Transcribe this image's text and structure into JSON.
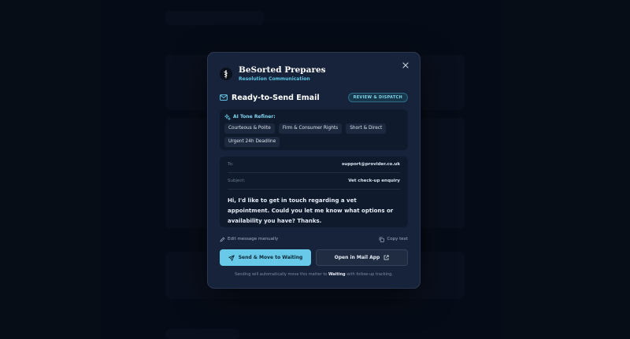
{
  "brand": {
    "title": "BeSorted Prepares",
    "subtitle": "Resolution Communication"
  },
  "email": {
    "title": "Ready-to-Send Email",
    "badge": "REVIEW & DISPATCH",
    "to_label": "To:",
    "to_value": "support@provider.co.uk",
    "subject_label": "Subject:",
    "subject_value": "Vet check-up enquiry",
    "body": "Hi, I'd like to get in touch regarding a vet appointment. Could you let me know what options or availability you have? Thanks."
  },
  "tone": {
    "label": "AI Tone Refiner:",
    "options": [
      "Courteous & Polite",
      "Firm & Consumer Rights",
      "Short & Direct",
      "Urgent 24h Deadline"
    ]
  },
  "actions": {
    "edit_label": "Edit message manually",
    "copy_label": "Copy text",
    "send_label": "Send & Move to Waiting",
    "open_label": "Open in Mail App"
  },
  "footer": {
    "pre": "Sending will automatically move this matter to ",
    "bold": "Waiting",
    "post": " with follow-up tracking."
  },
  "colors": {
    "accent": "#69c9e8",
    "modal_bg": "#17233a",
    "page_bg": "#070d18"
  }
}
